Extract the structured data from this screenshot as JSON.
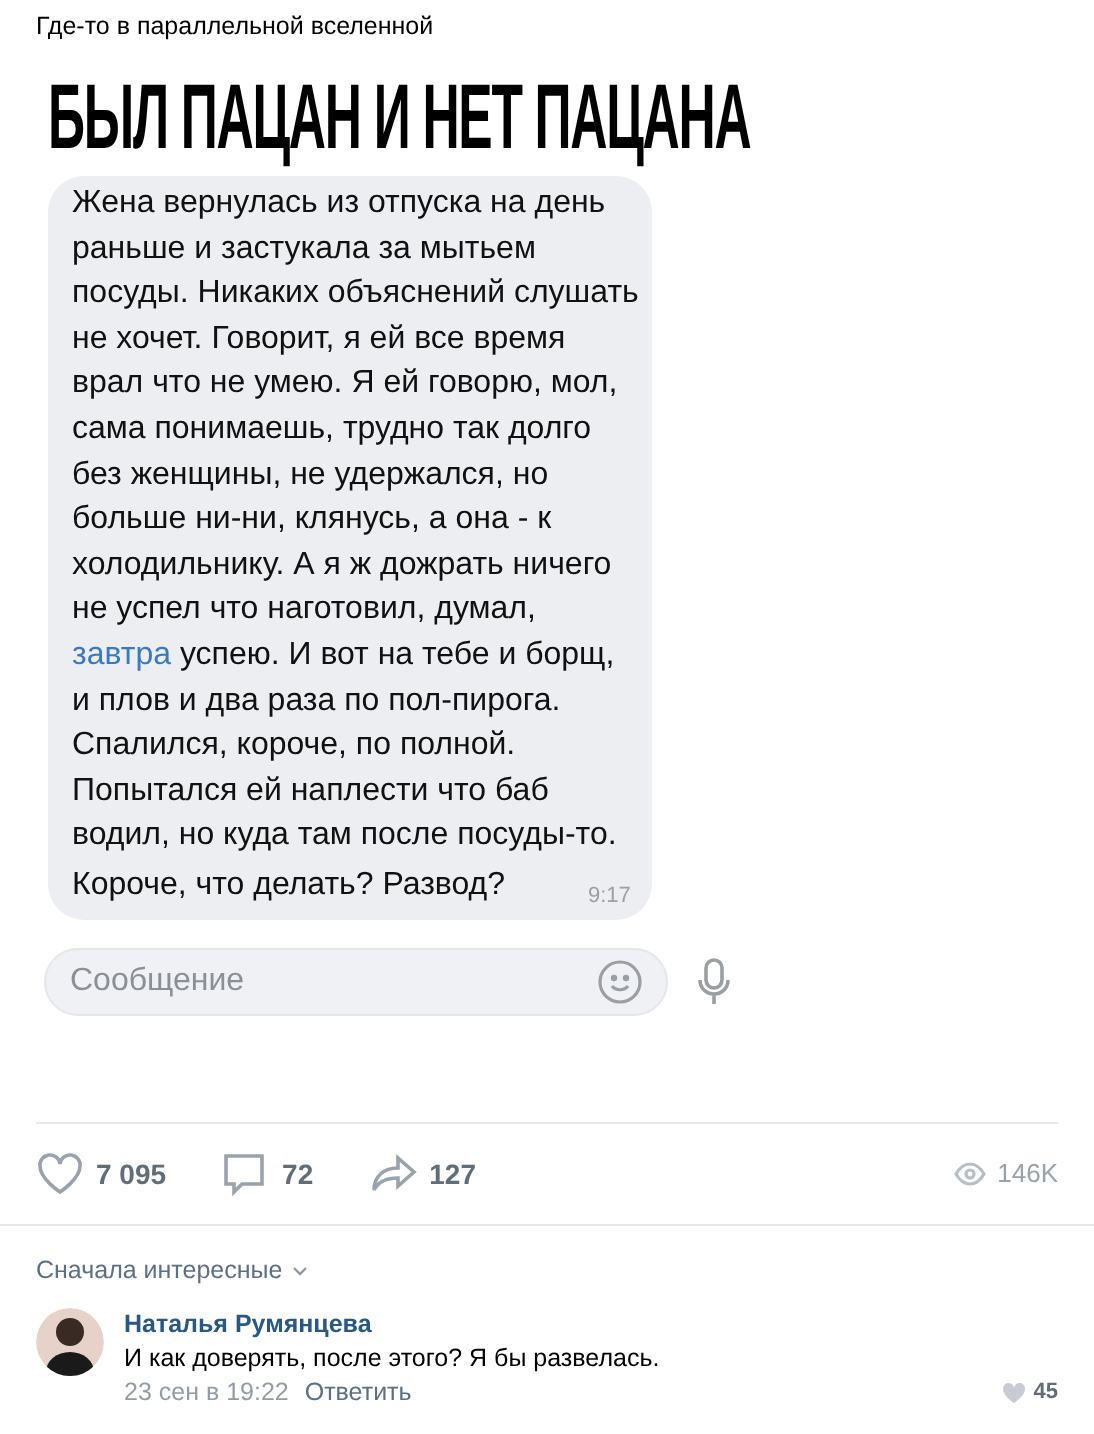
{
  "post_header": {
    "text": "Где-то в параллельной вселенной"
  },
  "title": "БЫЛ ПАЦАН И НЕТ ПАЦАНА",
  "message": {
    "text_before": "Жена вернулась из отпуска на день раньше и застукала за мытьем посуды. Никаких объяснений слушать не хочет. Говорит, я ей все время врал что не умею. Я ей говорю, мол, сама понимаешь, трудно так долго без женщины, не удержался, но больше ни-ни, клянусь, а она - к холодильнику. А я ж дожрать ничего не успел что наготовил, думал,",
    "link": "завтра",
    "text_after": "успею. И вот на тебе и борщ, и плов и два раза по пол-пирога. Спалился, короче, по полной. Попытался ей наплести что баб водил, но куда там после посуды-то.",
    "last_line": "Короче, что делать? Развод?",
    "time": "9:17"
  },
  "message_input": {
    "placeholder": "Сообщение"
  },
  "stats": {
    "likes": "7 095",
    "comments": "72",
    "shares": "127",
    "views": "146K"
  },
  "sort": {
    "label": "Сначала интересные"
  },
  "comments": [
    {
      "author": "Наталья Румянцева",
      "text": "И как доверять, после этого? Я бы развелась.",
      "date": "23 сен в 19:22",
      "reply": "Ответить",
      "likes": "45"
    }
  ]
}
